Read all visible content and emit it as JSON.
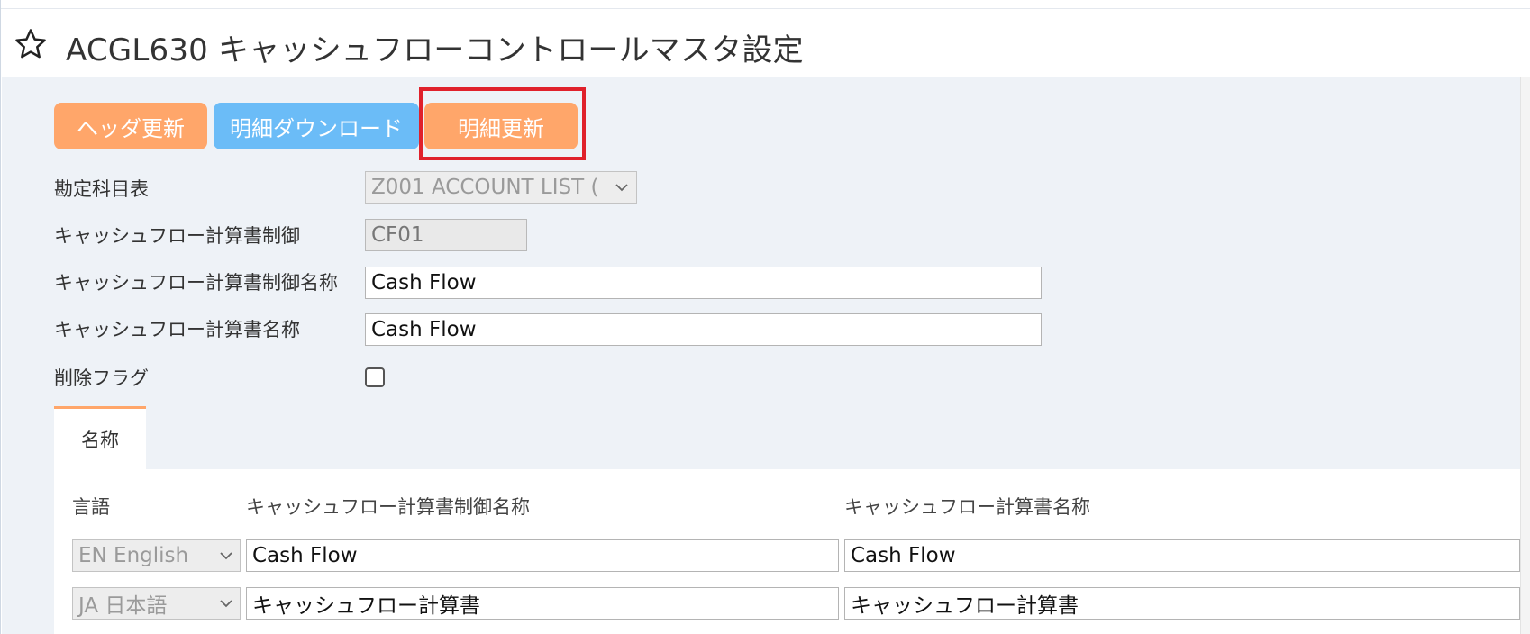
{
  "header": {
    "title": "ACGL630 キャッシュフローコントロールマスタ設定",
    "star_icon": "star-outline-icon"
  },
  "toolbar": {
    "header_update_label": "ヘッダ更新",
    "detail_download_label": "明細ダウンロード",
    "detail_update_label": "明細更新",
    "colors": {
      "orange": "#ffa66a",
      "blue": "#6bbcf7",
      "highlight": "#e0212b"
    }
  },
  "form": {
    "account_table_label": "勘定科目表",
    "account_table_value": "Z001 ACCOUNT LIST (",
    "cf_control_label": "キャッシュフロー計算書制御",
    "cf_control_value": "CF01",
    "cf_control_name_label": "キャッシュフロー計算書制御名称",
    "cf_control_name_value": "Cash Flow",
    "cf_name_label": "キャッシュフロー計算書名称",
    "cf_name_value": "Cash Flow",
    "delete_flag_label": "削除フラグ",
    "delete_flag_checked": false
  },
  "tabs": [
    {
      "label": "名称",
      "active": true
    }
  ],
  "names_table": {
    "headers": {
      "language": "言語",
      "control_name": "キャッシュフロー計算書制御名称",
      "statement_name": "キャッシュフロー計算書名称"
    },
    "rows": [
      {
        "language": "EN English",
        "control_name": "Cash Flow",
        "statement_name": "Cash Flow"
      },
      {
        "language": "JA 日本語",
        "control_name": "キャッシュフロー計算書",
        "statement_name": "キャッシュフロー計算書"
      }
    ]
  }
}
